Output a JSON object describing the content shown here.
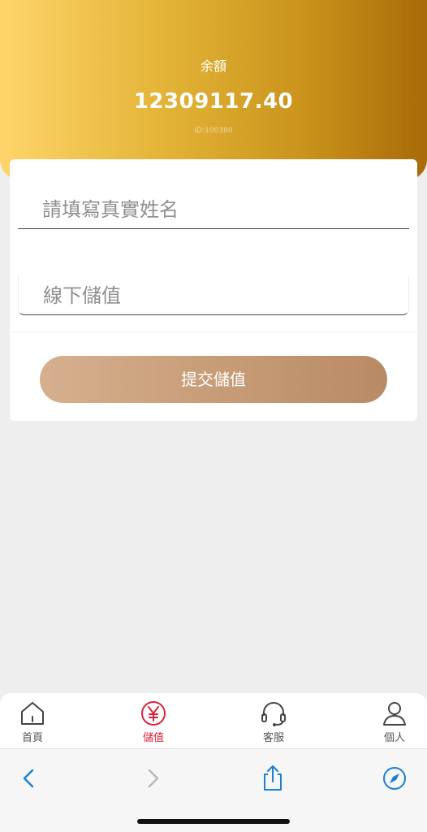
{
  "header": {
    "balance_label": "余額",
    "balance_value": "12309117.40",
    "user_id": "ID:100380"
  },
  "form": {
    "name_placeholder": "請填寫真實姓名",
    "amount_placeholder": "線下儲值",
    "submit_label": "提交儲值"
  },
  "tabbar": {
    "items": [
      {
        "label": "首頁",
        "icon": "home-icon",
        "active": false
      },
      {
        "label": "儲值",
        "icon": "yen-icon",
        "active": true
      },
      {
        "label": "客服",
        "icon": "headset-icon",
        "active": false
      },
      {
        "label": "個人",
        "icon": "user-icon",
        "active": false
      }
    ],
    "active_color": "#e0203a"
  },
  "browser": {
    "icons": [
      "back-icon",
      "forward-icon",
      "share-icon",
      "compass-icon"
    ],
    "accent": "#1a7fd6"
  },
  "colors": {
    "header_gradient": [
      "#ffd56b",
      "#a86b08"
    ],
    "button_gradient": [
      "#d6b08f",
      "#b98a66"
    ]
  }
}
